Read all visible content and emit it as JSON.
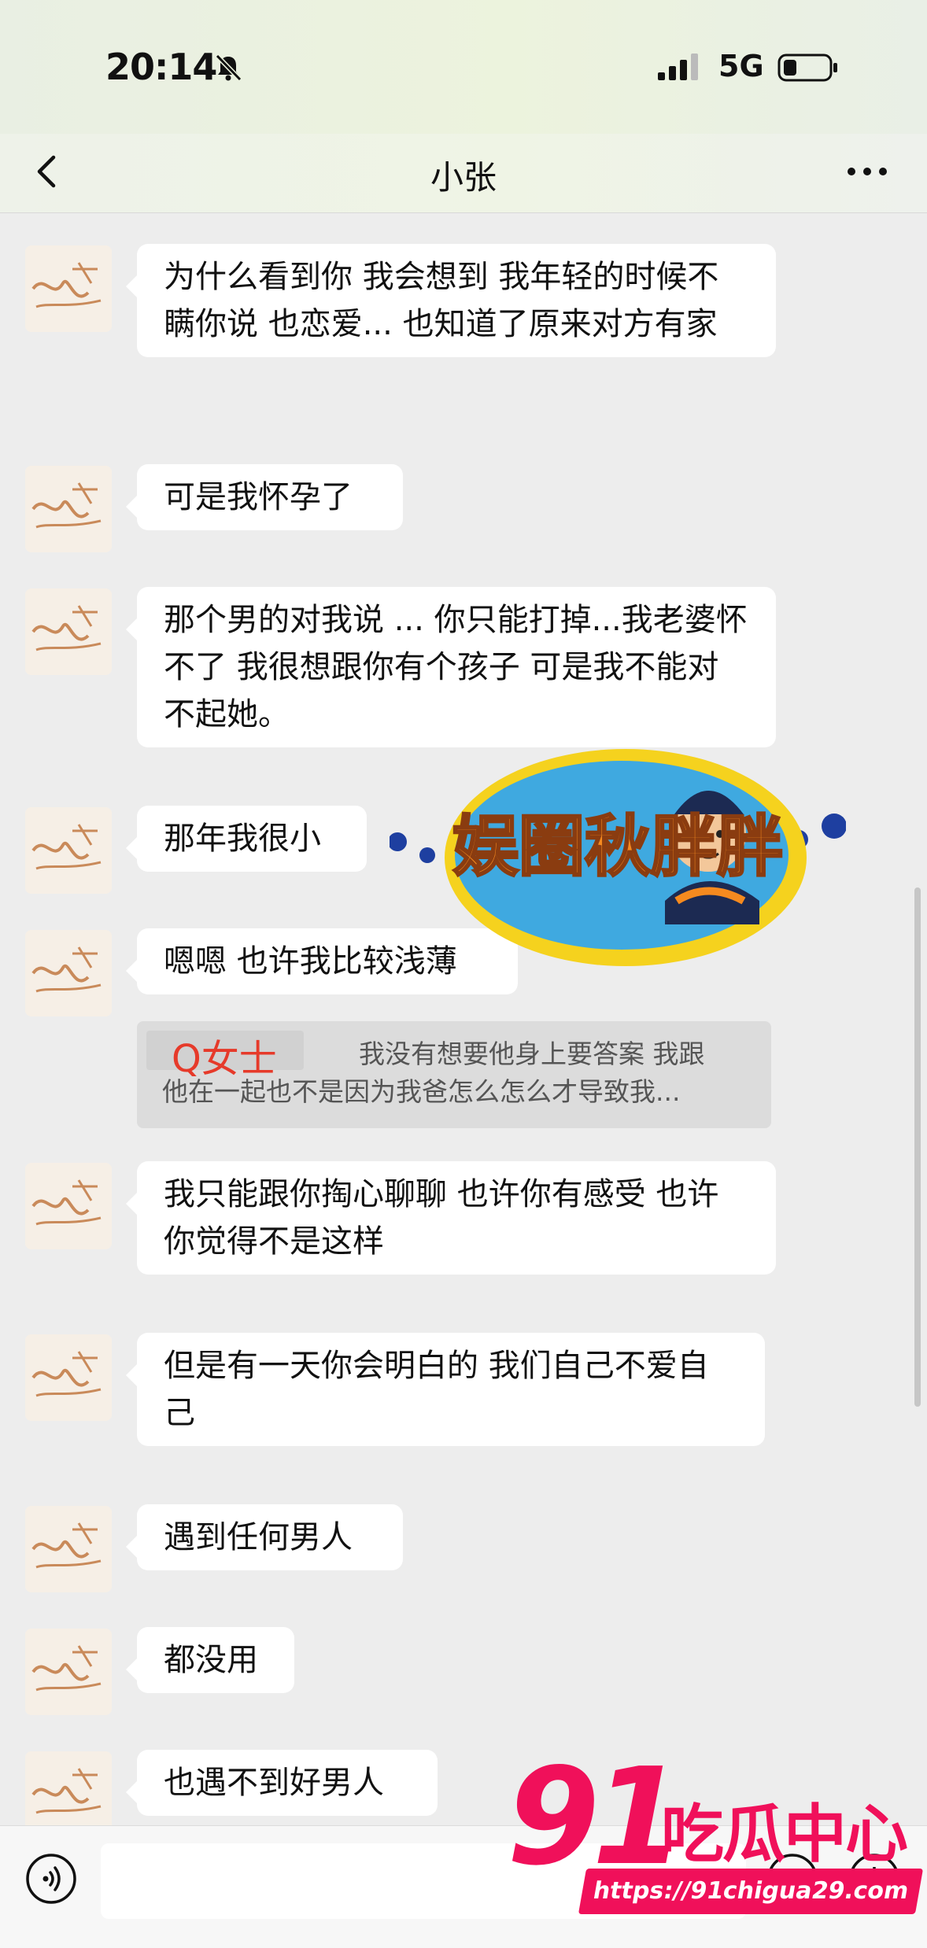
{
  "status_bar": {
    "time": "20:14",
    "network": "5G"
  },
  "nav": {
    "title": "小张"
  },
  "messages": [
    {
      "text": "为什么看到你 我会想到 我年轻的时候不瞒你说 也恋爱... 也知道了原来对方有家"
    },
    {
      "text": "可是我怀孕了"
    },
    {
      "text": "那个男的对我说 ... 你只能打掉...我老婆怀不了 我很想跟你有个孩子 可是我不能对不起她。"
    },
    {
      "text": "那年我很小"
    },
    {
      "text": "嗯嗯 也许我比较浅薄"
    },
    {
      "text": "我只能跟你掏心聊聊 也许你有感受 也许你觉得不是这样"
    },
    {
      "text": "但是有一天你会明白的 我们自己不爱自己"
    },
    {
      "text": "遇到任何男人"
    },
    {
      "text": "都没用"
    },
    {
      "text": "也遇不到好男人"
    }
  ],
  "quote": {
    "author": "Q女士",
    "line1": "我没有想要他身上要答案 我跟",
    "line2": "他在一起也不是因为我爸怎么怎么才导致我..."
  },
  "watermarks": {
    "logo_text": "娱圈秋胖胖",
    "site_number": "91",
    "site_name": "吃瓜中心",
    "site_url": "https://91chigua29.com"
  },
  "colors": {
    "chat_background": "#ededed",
    "bubble": "#ffffff",
    "watermark_pink": "#f0105a",
    "quote_author_red": "#e63a2a"
  }
}
